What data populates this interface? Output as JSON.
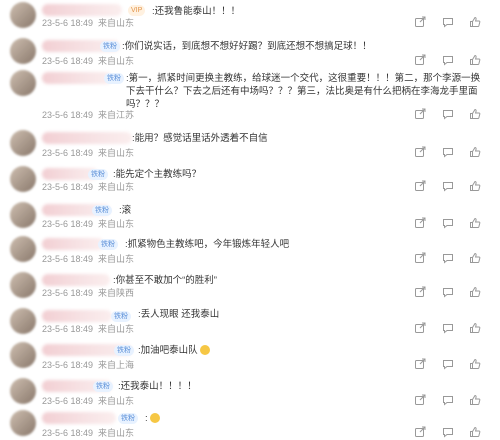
{
  "comments": [
    {
      "text": ":还我鲁能泰山！！！",
      "date": "23-5-6 18:49",
      "loc": "来自山东",
      "badge": "VIP"
    },
    {
      "text": ":你们说实话，到底想不想好好踢？到底还想不想搞足球！！",
      "date": "23-5-6 18:49",
      "loc": "来自山东",
      "badge": "铁粉"
    },
    {
      "text": ":第一，抓紧时间更换主教练，给球迷一个交代，这很重要！！！第二，那个李源一换下去干什么？下去之后还有中场吗？？？第三，法比奥是有什么把柄在李海龙手里面吗？？？",
      "date": "23-5-6 18:49",
      "loc": "来自江苏",
      "badge": "铁粉"
    },
    {
      "text": ":能用？感觉话里话外透着不自信",
      "date": "23-5-6 18:49",
      "loc": "来自山东",
      "badge": ""
    },
    {
      "text": ":能先定个主教练吗？",
      "date": "23-5-6 18:49",
      "loc": "来自山东",
      "badge": "铁粉"
    },
    {
      "text": ":滚",
      "date": "23-5-6 18:49",
      "loc": "来自山东",
      "badge": "铁粉"
    },
    {
      "text": ":抓紧物色主教练吧，今年锻炼年轻人吧",
      "date": "23-5-6 18:49",
      "loc": "来自山东",
      "badge": "铁粉"
    },
    {
      "text": ":你甚至不敢加个“的胜利”",
      "date": "23-5-6 18:49",
      "loc": "来自陕西",
      "badge": ""
    },
    {
      "text": ":丢人现眼  还我泰山",
      "date": "23-5-6 18:49",
      "loc": "来自山东",
      "badge": "铁粉"
    },
    {
      "text": ":加油吧泰山队",
      "date": "23-5-6 18:49",
      "loc": "来自上海",
      "badge": "铁粉",
      "emoji": true
    },
    {
      "text": ":还我泰山！！！！",
      "date": "23-5-6 18:49",
      "loc": "来自山东",
      "badge": "铁粉"
    },
    {
      "text": ":",
      "date": "23-5-6 18:49",
      "loc": "来自山东",
      "badge": "铁粉",
      "emoji": true
    }
  ],
  "icons": [
    "share-icon",
    "comment-icon",
    "like-icon"
  ],
  "colors": {
    "meta": "#999999",
    "badge_blue": "#5a8fd8",
    "badge_orange": "#e3954a",
    "name_blur": "#f2cfd3"
  }
}
